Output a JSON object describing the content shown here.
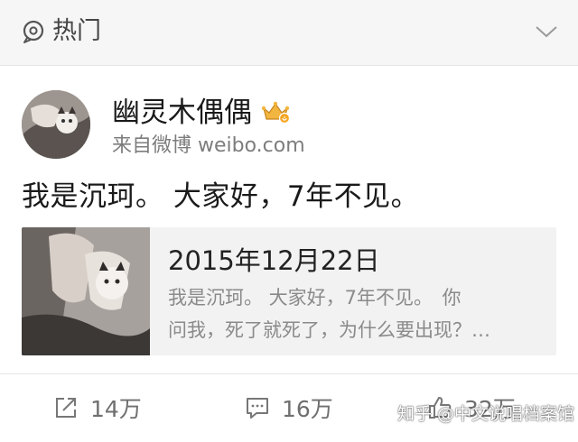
{
  "header": {
    "title": "热门",
    "icon": "hot-location-icon",
    "collapse_icon": "chevron-down-icon"
  },
  "post": {
    "username": "幽灵木偶偶",
    "badge_icon": "vip-crown-icon",
    "source": "来自微博 weibo.com",
    "text": "我是沉珂。 大家好，7年不见。",
    "avatar": "avatar-image"
  },
  "quoted_card": {
    "date": "2015年12月22日",
    "line1": "我是沉珂。 大家好，7年不见。　你",
    "line2": "问我，死了就死了，为什么要出现？…",
    "thumbnail": "hands-cat-photo"
  },
  "actions": {
    "share": {
      "icon": "share-icon",
      "count": "14万"
    },
    "comment": {
      "icon": "comment-icon",
      "count": "16万"
    },
    "like": {
      "icon": "thumbs-up-icon",
      "count": "32万"
    }
  },
  "watermark": {
    "text": "知乎 @中文说唱档案馆"
  },
  "colors": {
    "topbar_bg": "#f6f6f6",
    "card_bg": "#f2f2f2",
    "muted_text": "#7d7d7d",
    "badge_gold": "#e8a531"
  }
}
